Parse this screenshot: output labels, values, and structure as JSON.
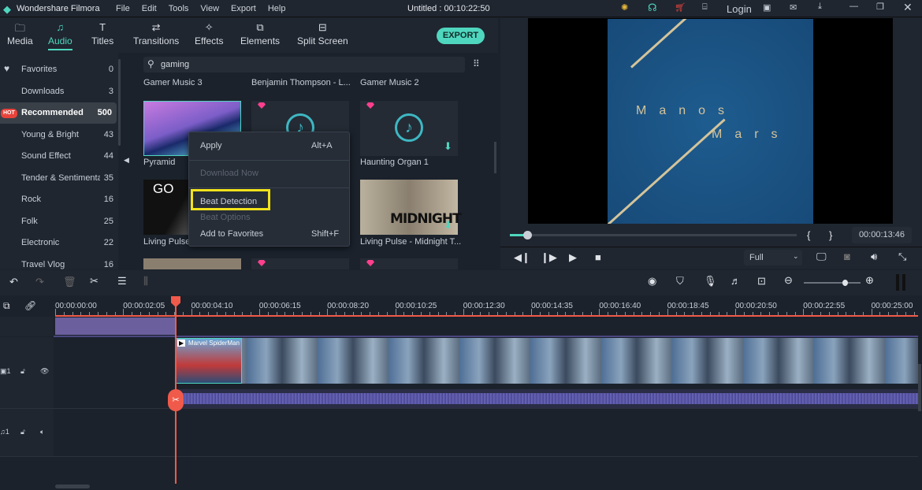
{
  "app": {
    "title": "Wondershare Filmora",
    "project": "Untitled : 00:10:22:50",
    "menu": [
      "File",
      "Edit",
      "Tools",
      "View",
      "Export",
      "Help"
    ],
    "login": "Login"
  },
  "tabs": [
    {
      "label": "Media",
      "icon": "folder-icon"
    },
    {
      "label": "Audio",
      "icon": "music-note-icon",
      "active": true
    },
    {
      "label": "Titles",
      "icon": "text-icon"
    },
    {
      "label": "Transitions",
      "icon": "transition-icon"
    },
    {
      "label": "Effects",
      "icon": "effects-icon"
    },
    {
      "label": "Elements",
      "icon": "elements-icon"
    },
    {
      "label": "Split Screen",
      "icon": "split-screen-icon"
    }
  ],
  "export_label": "EXPORT",
  "sidebar": {
    "items": [
      {
        "label": "Favorites",
        "count": "0"
      },
      {
        "label": "Downloads",
        "count": "3"
      },
      {
        "label": "Recommended",
        "count": "500",
        "badge": "HOT",
        "selected": true
      },
      {
        "label": "Young & Bright",
        "count": "43"
      },
      {
        "label": "Sound Effect",
        "count": "44"
      },
      {
        "label": "Tender & Sentimental",
        "count": "35"
      },
      {
        "label": "Rock",
        "count": "16"
      },
      {
        "label": "Folk",
        "count": "25"
      },
      {
        "label": "Electronic",
        "count": "22"
      },
      {
        "label": "Travel Vlog",
        "count": "16"
      }
    ]
  },
  "search": {
    "value": "gaming"
  },
  "library": {
    "top_row": [
      "Gamer Music 3",
      "Benjamin Thompson - L...",
      "Gamer Music 2"
    ],
    "cards": [
      "Pyramid",
      "",
      "Haunting Organ 1",
      "Living Pulse",
      "",
      "Living Pulse - Midnight T..."
    ],
    "thumb_text": {
      "go": "GO",
      "midnight": "MIDNIGHT"
    }
  },
  "context_menu": {
    "items": [
      {
        "label": "Apply",
        "shortcut": "Alt+A"
      },
      {
        "label": "Download Now",
        "disabled": true
      },
      {
        "label": "Beat Detection",
        "highlighted": true
      },
      {
        "label": "Beat Options",
        "disabled": true
      },
      {
        "label": "Add to Favorites",
        "shortcut": "Shift+F"
      }
    ]
  },
  "preview": {
    "title_line1": "Manos",
    "title_line2": "Mars",
    "timecode": "00:00:13:46",
    "progress": 0.06,
    "quality": "Full",
    "mark_in": "{",
    "mark_out": "}"
  },
  "timeline": {
    "ruler": [
      "00:00:00:00",
      "00:00:02:05",
      "00:00:04:10",
      "00:00:06:15",
      "00:00:08:20",
      "00:00:10:25",
      "00:00:12:30",
      "00:00:14:35",
      "00:00:16:40",
      "00:00:18:45",
      "00:00:20:50",
      "00:00:22:55",
      "00:00:25:00"
    ],
    "clip_title": "Marvel SpiderMan",
    "video_track": "1",
    "audio_track": "1",
    "zoom": 0.72
  },
  "colors": {
    "accent": "#4fd6be",
    "playhead": "#f05a4a",
    "highlight": "#f2e21b",
    "purple_clip": "#6b5f9e",
    "waveform": "#5b57a8"
  }
}
